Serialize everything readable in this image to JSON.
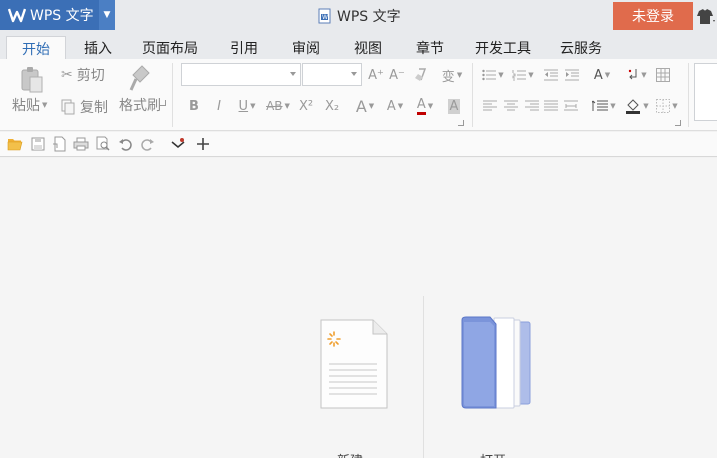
{
  "titlebar": {
    "app_name": "WPS 文字",
    "window_title": "WPS 文字",
    "login_label": "未登录",
    "app_color": "#3b6fb6",
    "login_color": "#e06b4c"
  },
  "tabs": [
    {
      "label": "开始",
      "active": true
    },
    {
      "label": "插入"
    },
    {
      "label": "页面布局"
    },
    {
      "label": "引用"
    },
    {
      "label": "审阅"
    },
    {
      "label": "视图"
    },
    {
      "label": "章节"
    },
    {
      "label": "开发工具"
    },
    {
      "label": "云服务"
    }
  ],
  "ribbon": {
    "paste_label": "粘贴",
    "cut_label": "剪切",
    "copy_label": "复制",
    "format_painter_label": "格式刷",
    "font_family_value": "",
    "font_size_value": "",
    "bold": "B",
    "italic": "I",
    "underline": "U",
    "strike": "AB",
    "superscript": "X²",
    "subscript": "X₂",
    "grow_font": "A⁺",
    "shrink_font": "A⁻",
    "font_color_letter": "A",
    "highlight_letter": "A",
    "style_letter": "A",
    "text_effect_letter": "A",
    "phonetic": "变"
  },
  "quickbar": {
    "icons": [
      "open-folder-icon",
      "save-icon",
      "save-pdf-icon",
      "print-icon",
      "print-preview-icon",
      "undo-icon",
      "redo-icon",
      "customize-icon",
      "add-icon"
    ]
  },
  "start": {
    "new_label": "新建",
    "open_label": "打开"
  }
}
